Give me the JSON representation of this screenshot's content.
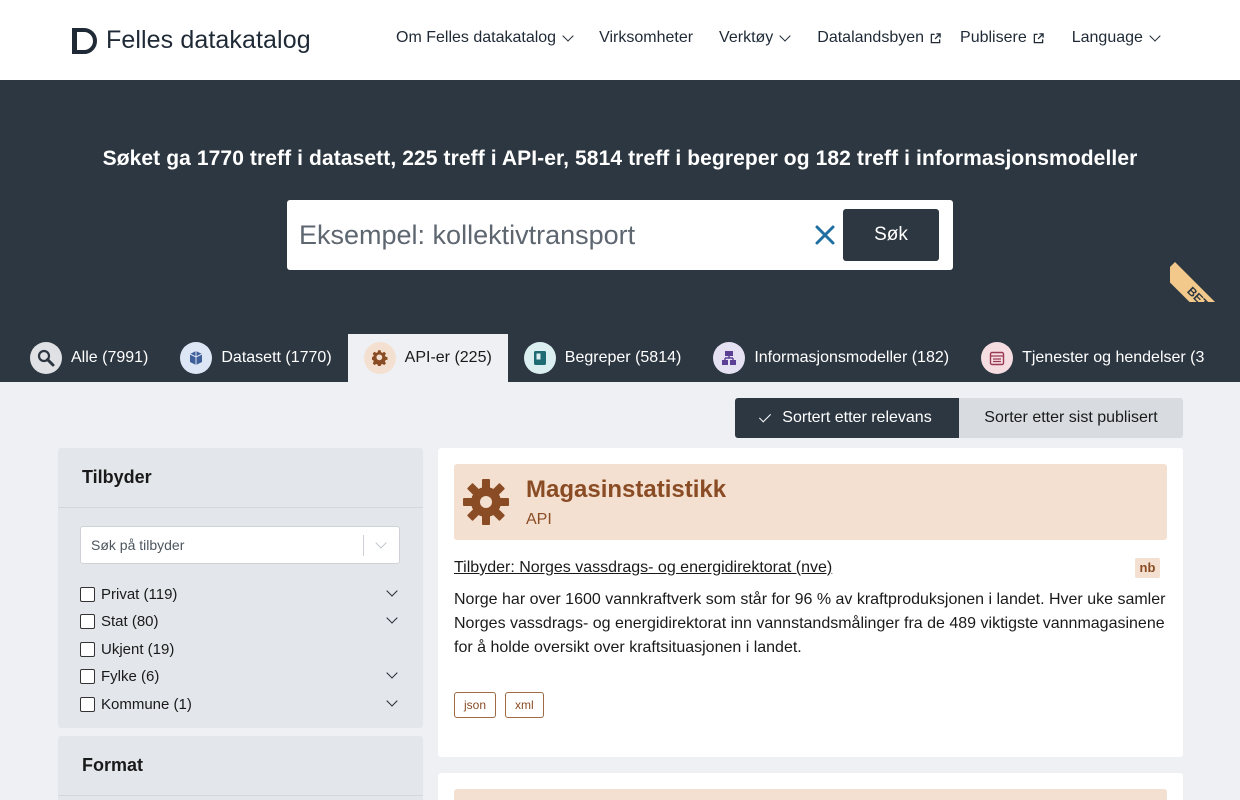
{
  "header": {
    "logo_text": "Felles datakatalog",
    "nav": [
      {
        "label": "Om Felles datakatalog",
        "type": "dropdown"
      },
      {
        "label": "Virksomheter",
        "type": "link"
      },
      {
        "label": "Verktøy",
        "type": "dropdown"
      },
      {
        "label": "Datalandsbyen",
        "type": "external"
      },
      {
        "label": "Publisere",
        "type": "external"
      },
      {
        "label": "Language",
        "type": "dropdown"
      }
    ]
  },
  "hero": {
    "title": "Søket ga 1770 treff i datasett, 225 treff i API-er, 5814 treff i begreper og 182 treff i informasjonsmodeller",
    "search_placeholder": "Eksempel: kollektivtransport",
    "search_button": "Søk",
    "clear_icon": "close-icon"
  },
  "tabs": [
    {
      "label": "Alle (7991)",
      "icon": "search-icon",
      "icon_bg": "#dfe1e4",
      "active": false
    },
    {
      "label": "Datasett (1770)",
      "icon": "cube-icon",
      "icon_bg": "#dde6f4",
      "active": false
    },
    {
      "label": "API-er (225)",
      "icon": "gear-icon",
      "icon_bg": "#f4e0d0",
      "active": true
    },
    {
      "label": "Begreper (5814)",
      "icon": "book-icon",
      "icon_bg": "#dbeef0",
      "active": false
    },
    {
      "label": "Informasjonsmodeller (182)",
      "icon": "diagram-icon",
      "icon_bg": "#e6e0f3",
      "active": false
    },
    {
      "label": "Tjenester og hendelser (3",
      "icon": "calendar-icon",
      "icon_bg": "#f6dde2",
      "active": false
    }
  ],
  "beta_label": "BETA",
  "sort": {
    "active_label": "Sortert etter relevans",
    "inactive_label": "Sorter etter sist publisert"
  },
  "filters": {
    "provider": {
      "title": "Tilbyder",
      "search_placeholder": "Søk på tilbyder",
      "options": [
        {
          "label": "Privat (119)",
          "expandable": true
        },
        {
          "label": "Stat (80)",
          "expandable": true
        },
        {
          "label": "Ukjent (19)",
          "expandable": false
        },
        {
          "label": "Fylke (6)",
          "expandable": true
        },
        {
          "label": "Kommune (1)",
          "expandable": true
        }
      ]
    },
    "format": {
      "title": "Format"
    }
  },
  "results": [
    {
      "title": "Magasinstatistikk",
      "type": "API",
      "provider": "Tilbyder: Norges vassdrags- og energidirektorat (nve)",
      "language": "nb",
      "description": "Norge har over 1600 vannkraftverk som står for 96 % av kraftproduksjonen i landet. Hver uke samler Norges vassdrags- og energidirektorat inn vannstandsmålinger fra de 489 viktigste vannmagasinene for å holde oversikt over kraftsituasjonen i landet.",
      "formats": [
        "json",
        "xml"
      ]
    }
  ],
  "colors": {
    "hero_bg": "#2d3741",
    "api_accent": "#8a4c24",
    "api_tint": "#f4e0d0"
  }
}
